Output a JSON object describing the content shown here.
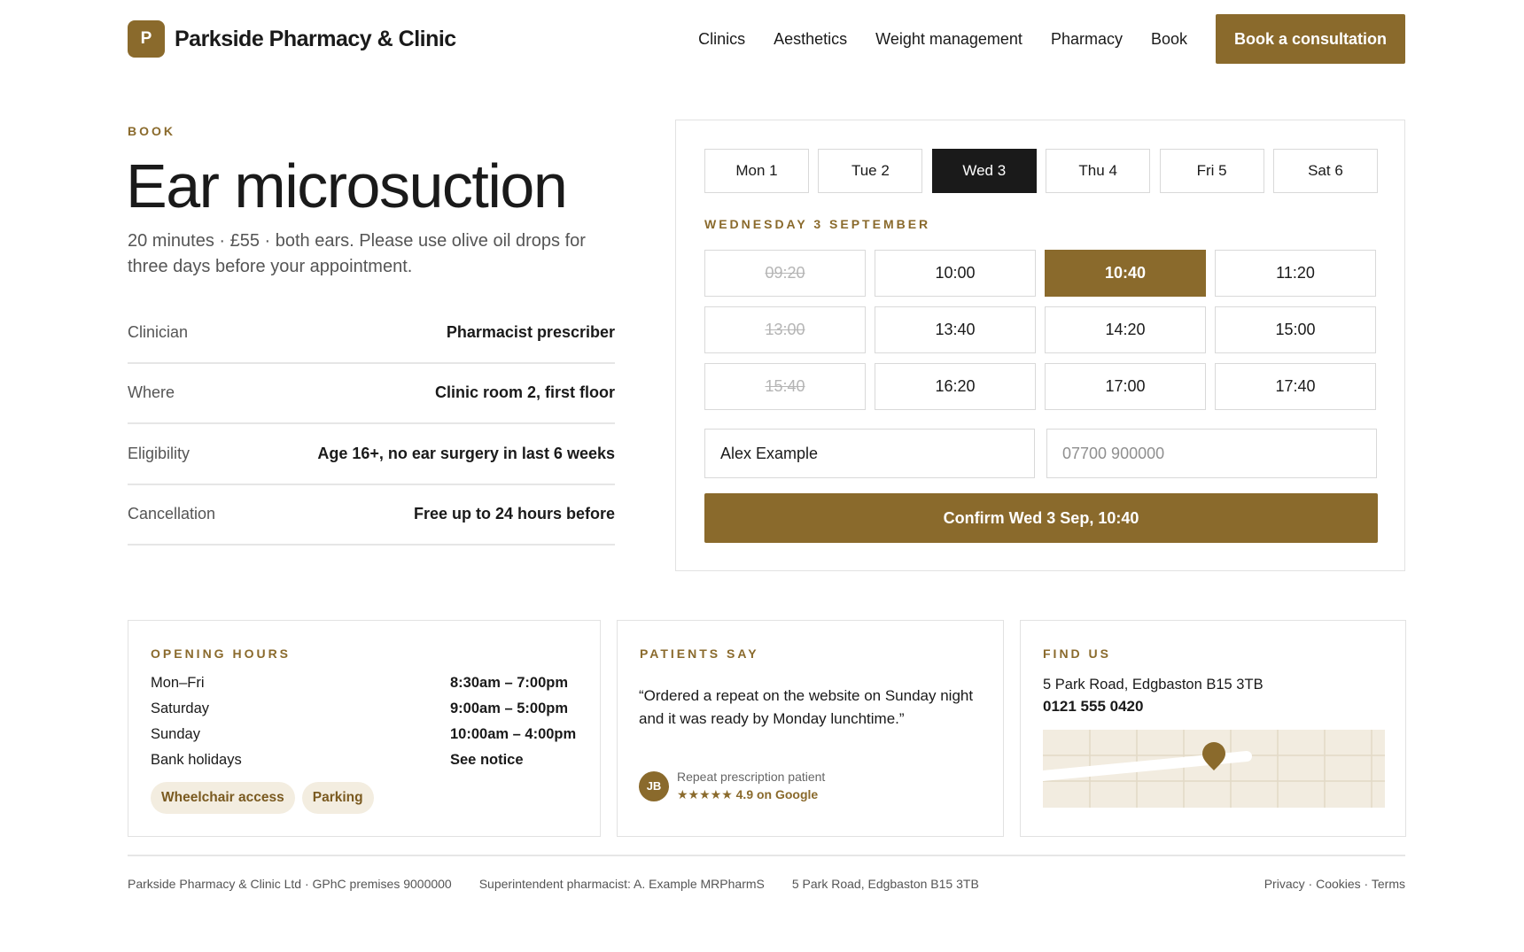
{
  "brand": {
    "logo_letter": "P",
    "name": "Parkside Pharmacy & Clinic"
  },
  "nav": {
    "links": [
      "Clinics",
      "Aesthetics",
      "Weight management",
      "Pharmacy",
      "Book"
    ],
    "cta": "Book a consultation"
  },
  "service": {
    "eyebrow": "BOOK",
    "title": "Ear microsuction",
    "description": "20 minutes · £55 · both ears. Please use olive oil drops for three days before your appointment.",
    "facts": [
      {
        "label": "Clinician",
        "value": "Pharmacist prescriber"
      },
      {
        "label": "Where",
        "value": "Clinic room 2, first floor"
      },
      {
        "label": "Eligibility",
        "value": "Age 16+, no ear surgery in last 6 weeks"
      },
      {
        "label": "Cancellation",
        "value": "Free up to 24 hours before"
      }
    ]
  },
  "booking": {
    "days": [
      {
        "label": "Mon 1",
        "selected": false
      },
      {
        "label": "Tue 2",
        "selected": false
      },
      {
        "label": "Wed 3",
        "selected": true
      },
      {
        "label": "Thu 4",
        "selected": false
      },
      {
        "label": "Fri 5",
        "selected": false
      },
      {
        "label": "Sat 6",
        "selected": false
      }
    ],
    "date_heading": "WEDNESDAY 3 SEPTEMBER",
    "slots": [
      {
        "time": "09:20",
        "state": "unavailable"
      },
      {
        "time": "10:00",
        "state": "available"
      },
      {
        "time": "10:40",
        "state": "selected"
      },
      {
        "time": "11:20",
        "state": "available"
      },
      {
        "time": "13:00",
        "state": "unavailable"
      },
      {
        "time": "13:40",
        "state": "available"
      },
      {
        "time": "14:20",
        "state": "available"
      },
      {
        "time": "15:00",
        "state": "available"
      },
      {
        "time": "15:40",
        "state": "unavailable"
      },
      {
        "time": "16:20",
        "state": "available"
      },
      {
        "time": "17:00",
        "state": "available"
      },
      {
        "time": "17:40",
        "state": "available"
      }
    ],
    "name_value": "Alex Example",
    "phone_placeholder": "07700 900000",
    "confirm": "Confirm Wed 3 Sep, 10:40"
  },
  "opening_hours": {
    "heading": "OPENING HOURS",
    "rows": [
      {
        "day": "Mon–Fri",
        "time": "8:30am – 7:00pm"
      },
      {
        "day": "Saturday",
        "time": "9:00am – 5:00pm"
      },
      {
        "day": "Sunday",
        "time": "10:00am – 4:00pm"
      },
      {
        "day": "Bank holidays",
        "time": "See notice"
      }
    ],
    "tags": [
      "Wheelchair access",
      "Parking"
    ]
  },
  "testimonial": {
    "heading": "PATIENTS SAY",
    "quote": "“Ordered a repeat on the website on Sunday night and it was ready by Monday lunchtime.”",
    "initials": "JB",
    "role": "Repeat prescription patient",
    "rating": "★★★★★ 4.9 on Google"
  },
  "find_us": {
    "heading": "FIND US",
    "address": "5 Park Road, Edgbaston B15 3TB",
    "phone": "0121 555 0420"
  },
  "footer": {
    "company": "Parkside Pharmacy & Clinic Ltd · GPhC premises 9000000",
    "superintendent": "Superintendent pharmacist: A. Example MRPharmS",
    "address": "5 Park Road, Edgbaston B15 3TB",
    "links": [
      "Privacy",
      "Cookies",
      "Terms"
    ]
  },
  "colors": {
    "accent": "#8a6a2c",
    "dark": "#1a1a1a",
    "muted": "#555555",
    "border": "#d9d9d9",
    "tint": "#f3ede0"
  }
}
